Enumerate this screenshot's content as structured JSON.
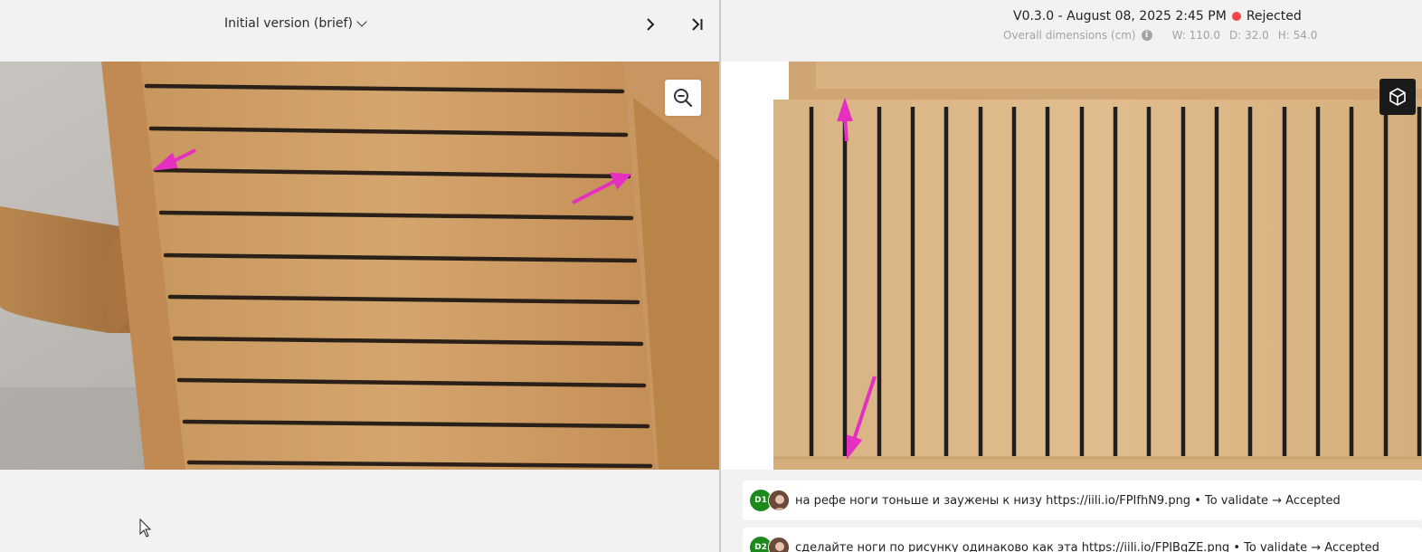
{
  "left": {
    "version_label": "Initial version (brief)",
    "icons": {
      "dropdown": "chevron-down-icon",
      "next": "chevron-right-icon",
      "last": "skip-to-end-icon",
      "zoom": "zoom-out-icon",
      "cursor": "mouse-pointer-icon"
    }
  },
  "right": {
    "version": "V0.3.0 - August 08, 2025 2:45 PM",
    "status": "Rejected",
    "status_color": "#f2464b",
    "dimensions_label": "Overall dimensions (cm)",
    "width": "W: 110.0",
    "depth": "D: 32.0",
    "height": "H: 54.0",
    "icons": {
      "info": "info-icon",
      "view3d": "cube-icon"
    }
  },
  "comments": [
    {
      "badge": "D1",
      "text": "на рефе ноги тоньше и заужены к низу https://iili.io/FPIfhN9.png • To validate → Accepted"
    },
    {
      "badge": "D2",
      "text": "сделайте ноги по рисунку одинаково как эта https://iili.io/FPIBgZE.png • To validate → Accepted"
    }
  ],
  "colors": {
    "annotation_arrow": "#e52fc0",
    "badge_green": "#1b8a1b"
  }
}
